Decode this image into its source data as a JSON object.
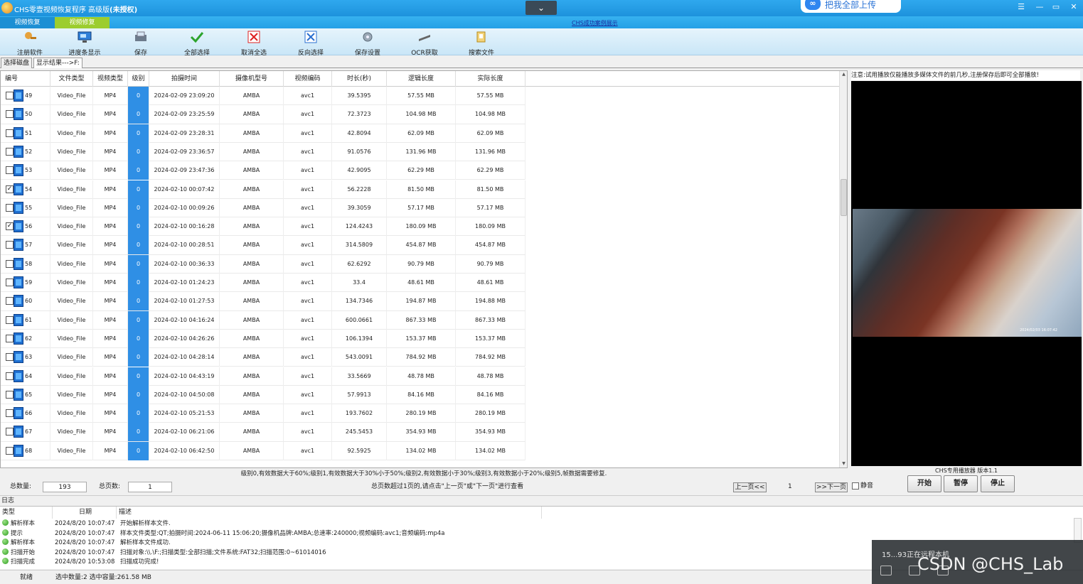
{
  "window": {
    "title_main": "CHS零壹视频恢复程序 高级版",
    "title_suffix": "(未授权)",
    "collapse_glyph": "⌄",
    "cloud_button": "把我全部上传",
    "controls": {
      "menu": "☰",
      "minimize": "—",
      "restore": "▭",
      "close": "✕"
    }
  },
  "ribbon": {
    "tabs": [
      "视频恢复",
      "视频修复"
    ],
    "demo_link": "CHS成功案例展示"
  },
  "toolbar": {
    "buttons": [
      {
        "label": "注册软件",
        "icon": "register-icon"
      },
      {
        "label": "进度条显示",
        "icon": "progress-monitor-icon"
      },
      {
        "label": "保存",
        "icon": "save-icon"
      },
      {
        "label": "全部选择",
        "icon": "check-all-icon"
      },
      {
        "label": "取消全选",
        "icon": "uncheck-all-icon"
      },
      {
        "label": "反向选择",
        "icon": "invert-selection-icon"
      },
      {
        "label": "保存设置",
        "icon": "save-settings-icon"
      },
      {
        "label": "OCR获取",
        "icon": "ocr-icon"
      },
      {
        "label": "搜索文件",
        "icon": "search-file-icon"
      }
    ]
  },
  "view_tabs": [
    "选择磁盘",
    "显示结果--->F:"
  ],
  "table": {
    "columns": [
      "编号",
      "文件类型",
      "视频类型",
      "级别",
      "拍摄时间",
      "摄像机型号",
      "视频编码",
      "时长(秒)",
      "逻辑长度",
      "实际长度"
    ],
    "rows": [
      {
        "id": "49",
        "checked": false,
        "type": "Video_File",
        "vtype": "MP4",
        "level": "0",
        "time": "2024-02-09 23:09:20",
        "camera": "AMBA",
        "codec": "avc1",
        "duration": "39.5395",
        "logical": "57.55 MB",
        "actual": "57.55 MB"
      },
      {
        "id": "50",
        "checked": false,
        "type": "Video_File",
        "vtype": "MP4",
        "level": "0",
        "time": "2024-02-09 23:25:59",
        "camera": "AMBA",
        "codec": "avc1",
        "duration": "72.3723",
        "logical": "104.98 MB",
        "actual": "104.98 MB"
      },
      {
        "id": "51",
        "checked": false,
        "type": "Video_File",
        "vtype": "MP4",
        "level": "0",
        "time": "2024-02-09 23:28:31",
        "camera": "AMBA",
        "codec": "avc1",
        "duration": "42.8094",
        "logical": "62.09 MB",
        "actual": "62.09 MB"
      },
      {
        "id": "52",
        "checked": false,
        "type": "Video_File",
        "vtype": "MP4",
        "level": "0",
        "time": "2024-02-09 23:36:57",
        "camera": "AMBA",
        "codec": "avc1",
        "duration": "91.0576",
        "logical": "131.96 MB",
        "actual": "131.96 MB"
      },
      {
        "id": "53",
        "checked": false,
        "type": "Video_File",
        "vtype": "MP4",
        "level": "0",
        "time": "2024-02-09 23:47:36",
        "camera": "AMBA",
        "codec": "avc1",
        "duration": "42.9095",
        "logical": "62.29 MB",
        "actual": "62.29 MB"
      },
      {
        "id": "54",
        "checked": true,
        "type": "Video_File",
        "vtype": "MP4",
        "level": "0",
        "time": "2024-02-10 00:07:42",
        "camera": "AMBA",
        "codec": "avc1",
        "duration": "56.2228",
        "logical": "81.50 MB",
        "actual": "81.50 MB"
      },
      {
        "id": "55",
        "checked": false,
        "type": "Video_File",
        "vtype": "MP4",
        "level": "0",
        "time": "2024-02-10 00:09:26",
        "camera": "AMBA",
        "codec": "avc1",
        "duration": "39.3059",
        "logical": "57.17 MB",
        "actual": "57.17 MB"
      },
      {
        "id": "56",
        "checked": true,
        "type": "Video_File",
        "vtype": "MP4",
        "level": "0",
        "time": "2024-02-10 00:16:28",
        "camera": "AMBA",
        "codec": "avc1",
        "duration": "124.4243",
        "logical": "180.09 MB",
        "actual": "180.09 MB"
      },
      {
        "id": "57",
        "checked": false,
        "type": "Video_File",
        "vtype": "MP4",
        "level": "0",
        "time": "2024-02-10 00:28:51",
        "camera": "AMBA",
        "codec": "avc1",
        "duration": "314.5809",
        "logical": "454.87 MB",
        "actual": "454.87 MB"
      },
      {
        "id": "58",
        "checked": false,
        "type": "Video_File",
        "vtype": "MP4",
        "level": "0",
        "time": "2024-02-10 00:36:33",
        "camera": "AMBA",
        "codec": "avc1",
        "duration": "62.6292",
        "logical": "90.79 MB",
        "actual": "90.79 MB"
      },
      {
        "id": "59",
        "checked": false,
        "type": "Video_File",
        "vtype": "MP4",
        "level": "0",
        "time": "2024-02-10 01:24:23",
        "camera": "AMBA",
        "codec": "avc1",
        "duration": "33.4",
        "logical": "48.61 MB",
        "actual": "48.61 MB"
      },
      {
        "id": "60",
        "checked": false,
        "type": "Video_File",
        "vtype": "MP4",
        "level": "0",
        "time": "2024-02-10 01:27:53",
        "camera": "AMBA",
        "codec": "avc1",
        "duration": "134.7346",
        "logical": "194.87 MB",
        "actual": "194.88 MB"
      },
      {
        "id": "61",
        "checked": false,
        "type": "Video_File",
        "vtype": "MP4",
        "level": "0",
        "time": "2024-02-10 04:16:24",
        "camera": "AMBA",
        "codec": "avc1",
        "duration": "600.0661",
        "logical": "867.33 MB",
        "actual": "867.33 MB"
      },
      {
        "id": "62",
        "checked": false,
        "type": "Video_File",
        "vtype": "MP4",
        "level": "0",
        "time": "2024-02-10 04:26:26",
        "camera": "AMBA",
        "codec": "avc1",
        "duration": "106.1394",
        "logical": "153.37 MB",
        "actual": "153.37 MB"
      },
      {
        "id": "63",
        "checked": false,
        "type": "Video_File",
        "vtype": "MP4",
        "level": "0",
        "time": "2024-02-10 04:28:14",
        "camera": "AMBA",
        "codec": "avc1",
        "duration": "543.0091",
        "logical": "784.92 MB",
        "actual": "784.92 MB"
      },
      {
        "id": "64",
        "checked": false,
        "type": "Video_File",
        "vtype": "MP4",
        "level": "0",
        "time": "2024-02-10 04:43:19",
        "camera": "AMBA",
        "codec": "avc1",
        "duration": "33.5669",
        "logical": "48.78 MB",
        "actual": "48.78 MB"
      },
      {
        "id": "65",
        "checked": false,
        "type": "Video_File",
        "vtype": "MP4",
        "level": "0",
        "time": "2024-02-10 04:50:08",
        "camera": "AMBA",
        "codec": "avc1",
        "duration": "57.9913",
        "logical": "84.16 MB",
        "actual": "84.16 MB"
      },
      {
        "id": "66",
        "checked": false,
        "type": "Video_File",
        "vtype": "MP4",
        "level": "0",
        "time": "2024-02-10 05:21:53",
        "camera": "AMBA",
        "codec": "avc1",
        "duration": "193.7602",
        "logical": "280.19 MB",
        "actual": "280.19 MB"
      },
      {
        "id": "67",
        "checked": false,
        "type": "Video_File",
        "vtype": "MP4",
        "level": "0",
        "time": "2024-02-10 06:21:06",
        "camera": "AMBA",
        "codec": "avc1",
        "duration": "245.5453",
        "logical": "354.93 MB",
        "actual": "354.93 MB"
      },
      {
        "id": "68",
        "checked": false,
        "type": "Video_File",
        "vtype": "MP4",
        "level": "0",
        "time": "2024-02-10 06:42:50",
        "camera": "AMBA",
        "codec": "avc1",
        "duration": "92.5925",
        "logical": "134.02 MB",
        "actual": "134.02 MB"
      }
    ],
    "level_note": "级别0,有效数据大于60%;级别1,有效数据大于30%小于50%;级别2,有效数据小于30%;级别3,有效数据小于20%;级别5,帧数据需要修复."
  },
  "pager": {
    "total_label": "总数量:",
    "total_value": "193",
    "pages_label": "总页数:",
    "pages_value": "1",
    "hint": "总页数超过1页的,请点击\"上一页\"或\"下一页\"进行查看",
    "prev_label": "上一页<<",
    "current_page": "1",
    "next_label": ">>下一页"
  },
  "preview": {
    "notice": "注意:试用播放仅能播放多媒体文件的前几秒,注册保存后即可全部播放!",
    "timestamp": "2024/02/03 16:07:42",
    "player_label": "CHS专用播放器 版本1.1",
    "mute_label": "静音",
    "start_label": "开始",
    "pause_label": "暂停",
    "stop_label": "停止"
  },
  "log": {
    "section_label": "日志",
    "columns": [
      "类型",
      "日期",
      "描述"
    ],
    "rows": [
      {
        "type": "解析样本",
        "date": "2024/8/20 10:07:47",
        "desc": "开始解析样本文件."
      },
      {
        "type": "提示",
        "date": "2024/8/20 10:07:47",
        "desc": "样本文件类型:QT;拍摄时间:2024-06-11 15:06:20;摄像机品牌:AMBA;总速率:240000;视频编码:avc1;音频编码:mp4a"
      },
      {
        "type": "解析样本",
        "date": "2024/8/20 10:07:47",
        "desc": "解析样本文件成功."
      },
      {
        "type": "扫描开始",
        "date": "2024/8/20 10:07:47",
        "desc": "扫描对象:\\\\.\\F:;扫描类型:全部扫描;文件系统:FAT32;扫描范围:0~61014016"
      },
      {
        "type": "扫描完成",
        "date": "2024/8/20 10:53:08",
        "desc": "扫描成功完成!"
      }
    ]
  },
  "status": {
    "state": "就绪",
    "selection": "选中数量:2 选中容量:261.58 MB"
  },
  "overlay": {
    "remote_text": "15...93正在远程本机",
    "watermark": "CSDN @CHS_Lab"
  }
}
